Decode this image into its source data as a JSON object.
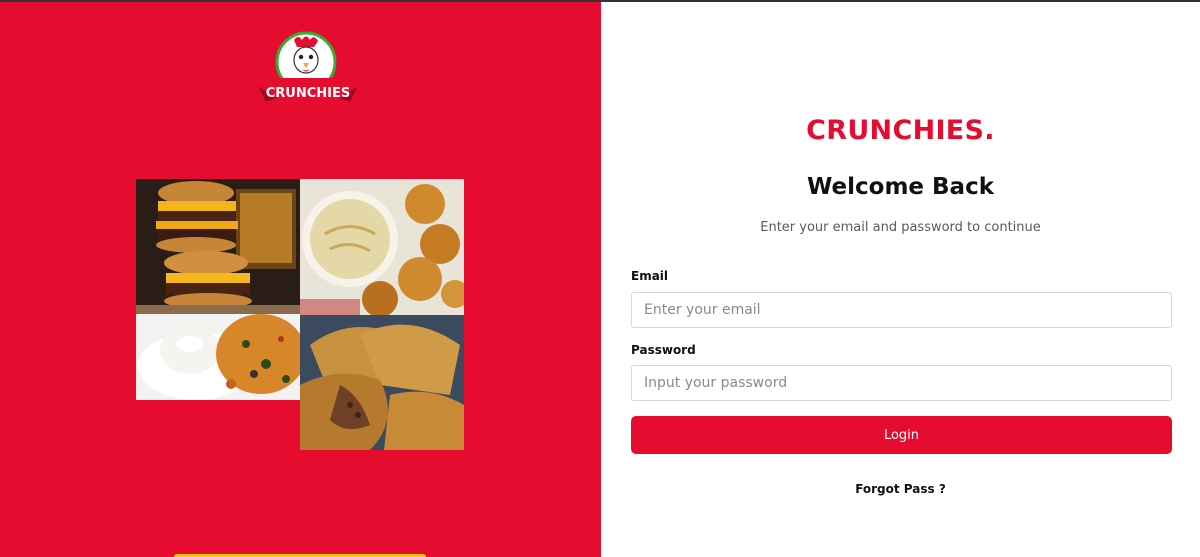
{
  "brand": {
    "logo_text": "CRUNCHIES",
    "title": "CRUNCHIES."
  },
  "colors": {
    "primary_red": "#e60c2f",
    "accent_yellow": "#f5c518",
    "text_dark": "#111111",
    "text_muted": "#5a5a5a"
  },
  "gallery": {
    "items": [
      "burger-stack-image",
      "soup-and-puff-image",
      "bun-and-sauce-image",
      "meat-pie-image"
    ]
  },
  "form": {
    "heading": "Welcome Back",
    "subtitle": "Enter your email and password to continue",
    "email_label": "Email",
    "email_placeholder": "Enter your email",
    "email_value": "",
    "password_label": "Password",
    "password_placeholder": "Input your password",
    "password_value": "",
    "login_label": "Login",
    "forgot_label": "Forgot Pass ?"
  }
}
